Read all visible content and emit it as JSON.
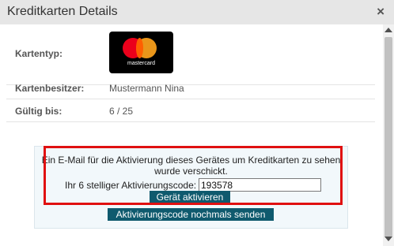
{
  "dialog": {
    "title": "Kreditkarten Details",
    "close_symbol": "×"
  },
  "details": {
    "card_type_label": "Kartentyp:",
    "card_brand": "mastercard",
    "card_holder_label": "Kartenbesitzer:",
    "card_holder_value": "Mustermann Nina",
    "valid_until_label": "Gültig bis:",
    "valid_until_value": "6 / 25"
  },
  "activation": {
    "message": "Ein E-Mail für die Aktivierung dieses Gerätes um Kreditkarten zu sehen wurde verschickt.",
    "code_label": "Ihr 6 stelliger Aktivierungscode:",
    "code_value": "193578",
    "activate_button": "Gerät aktivieren",
    "resend_button": "Aktivierungscode nochmals senden"
  },
  "colors": {
    "button_bg": "#0f5a6e",
    "highlight_border": "#e01010",
    "mastercard_red": "#eb001b",
    "mastercard_yellow": "#f79e1b"
  },
  "icons": {
    "close": "close-icon",
    "card": "mastercard-logo"
  }
}
